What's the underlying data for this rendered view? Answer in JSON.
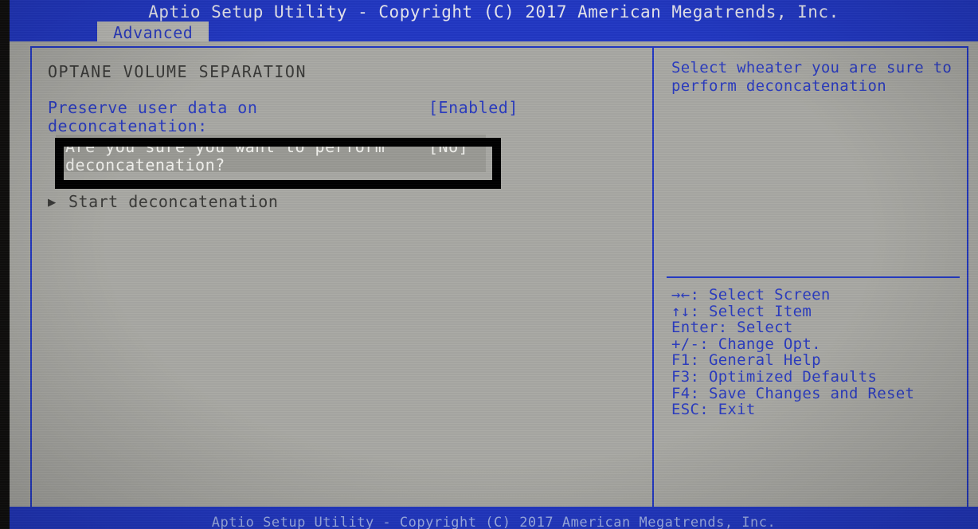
{
  "window": {
    "title": "Aptio Setup Utility - Copyright (C) 2017 American Megatrends, Inc.",
    "footer": "Aptio Setup Utility - Copyright (C) 2017 American Megatrends, Inc."
  },
  "tabs": [
    {
      "label": "Advanced",
      "active": true
    }
  ],
  "main": {
    "section_header": "OPTANE VOLUME SEPARATION",
    "rows": [
      {
        "label": "Preserve user data on deconcatenation:",
        "value": "[Enabled]",
        "selected": false
      },
      {
        "label": "Are you sure you want to perform deconcatenation?",
        "value": "[No]",
        "selected": true
      }
    ],
    "submenu": {
      "marker": "▶",
      "label": "Start deconcatenation"
    }
  },
  "help": {
    "text": "Select wheater you are sure to perform deconcatenation",
    "keys": [
      "→←: Select Screen",
      "↑↓: Select Item",
      "Enter: Select",
      "+/-: Change Opt.",
      "F1: General Help",
      "F3: Optimized Defaults",
      "F4: Save Changes and Reset",
      "ESC: Exit"
    ]
  },
  "colors": {
    "accent_blue": "#2238c4",
    "text_blue": "#2a3bbf",
    "screen_gray": "#a9a9a4",
    "selected_gray": "#9a9a95",
    "selected_text": "#f2f2ee",
    "dark_text": "#3a3a38",
    "annotation_black": "#000000"
  }
}
